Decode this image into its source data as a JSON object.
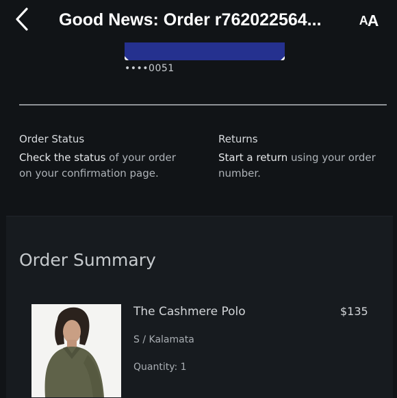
{
  "header": {
    "title": "Good News: Order r762022564...",
    "text_size_small": "A",
    "text_size_large": "A"
  },
  "payment": {
    "card_number": "••••0051"
  },
  "order_status": {
    "heading": "Order Status",
    "link_text": "Check the status",
    "body_text": " of your order on your confirmation page."
  },
  "returns": {
    "heading": "Returns",
    "link_text": "Start a return",
    "body_text": " using your order number."
  },
  "summary": {
    "title": "Order Summary",
    "items": [
      {
        "name": "The Cashmere Polo",
        "price": "$135",
        "variant": "S / Kalamata",
        "quantity": "Quantity: 1"
      }
    ]
  },
  "icons": {
    "back": "chevron-left-icon",
    "text_size": "text-size-icon"
  },
  "colors": {
    "background": "#111417",
    "card_banner": "#25318f",
    "panel": "#171b1f"
  }
}
